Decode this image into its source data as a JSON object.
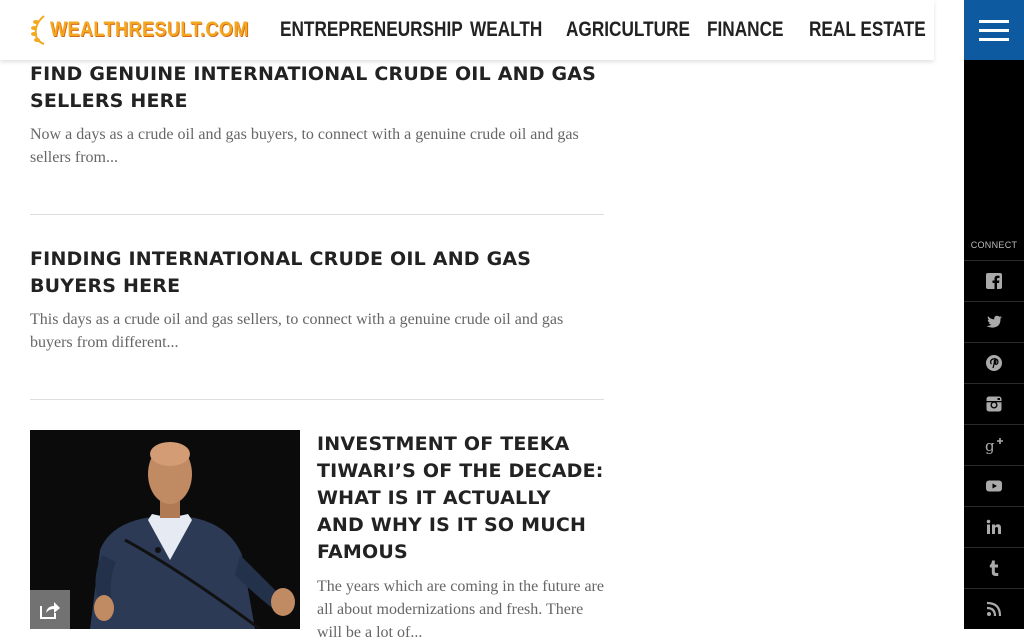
{
  "site": {
    "logo_text": "WEALTHRESULT.COM",
    "brand_color": "#f4a81f",
    "accent_color": "#0e5aa0"
  },
  "nav": {
    "items": [
      {
        "label": "ENTREPRENEURSHIP"
      },
      {
        "label": "WEALTH"
      },
      {
        "label": "AGRICULTURE"
      },
      {
        "label": "FINANCE"
      },
      {
        "label": "REAL ESTATE"
      }
    ]
  },
  "social": {
    "label": "CONNECT",
    "icons": [
      "facebook-icon",
      "twitter-icon",
      "pinterest-icon",
      "instagram-icon",
      "google-plus-icon",
      "youtube-icon",
      "linkedin-icon",
      "tumblr-icon",
      "rss-icon"
    ]
  },
  "articles": [
    {
      "title": "FIND GENUINE INTERNATIONAL CRUDE OIL AND GAS SELLERS HERE",
      "excerpt": "Now a days as a crude oil and gas buyers, to connect with a genuine crude oil and gas sellers from..."
    },
    {
      "title": "FINDING INTERNATIONAL CRUDE OIL AND GAS BUYERS HERE",
      "excerpt": "This days as a crude oil and gas sellers, to connect with a genuine crude oil and gas buyers from different..."
    },
    {
      "title": "INVESTMENT OF TEEKA TIWARI’S OF THE DECADE: WHAT IS IT ACTUALLY AND WHY IS IT SO MUCH FAMOUS",
      "excerpt": "The years which are coming in the future are all about modernizations and fresh. There will be a lot of..."
    }
  ]
}
